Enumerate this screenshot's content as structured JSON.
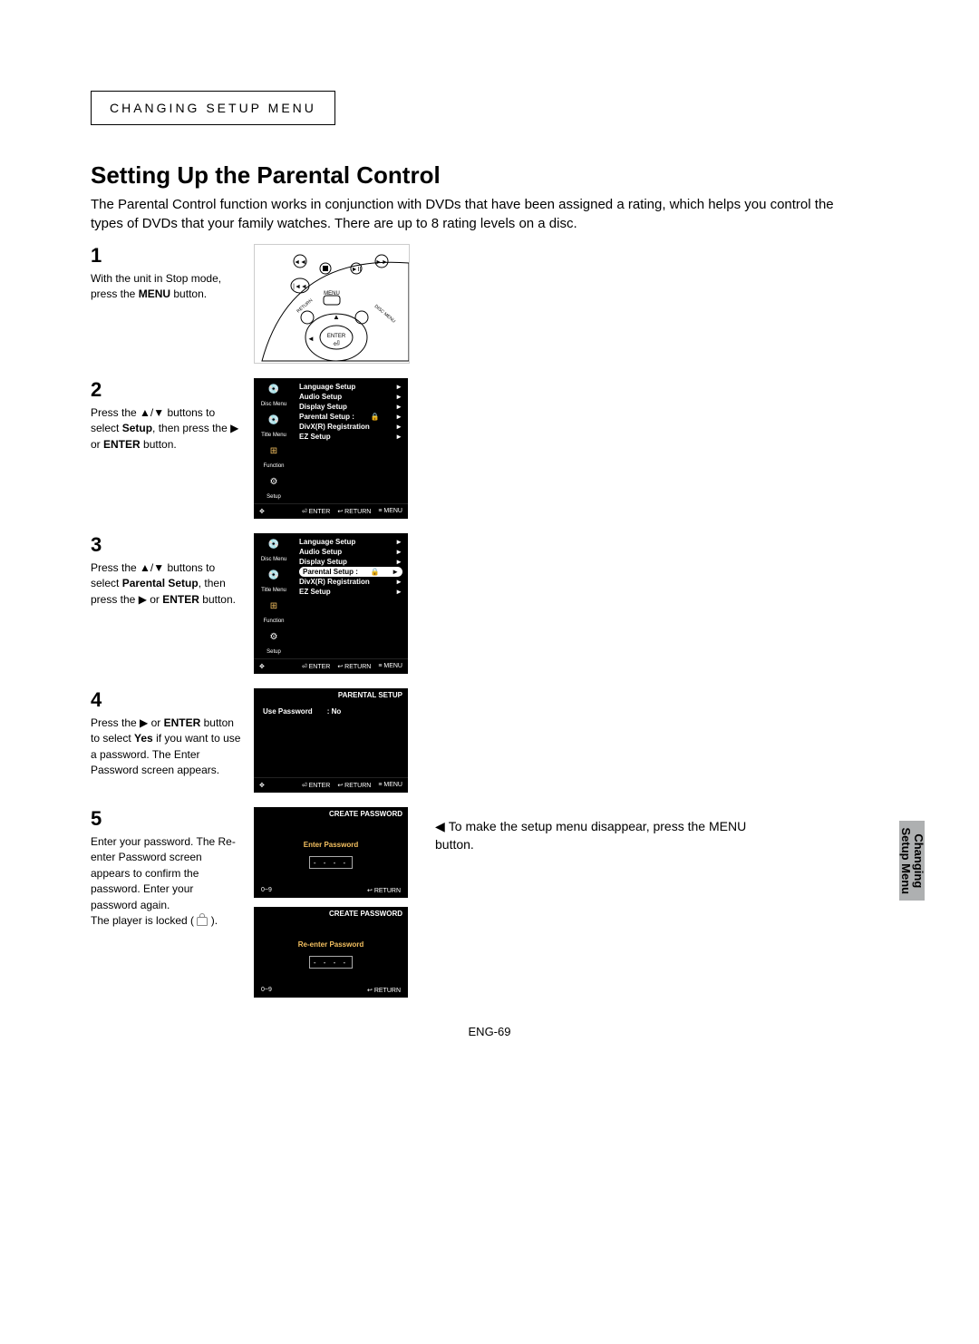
{
  "header": "CHANGING SETUP MENU",
  "title": "Setting Up the Parental Control",
  "intro": "The Parental Control function works in conjunction with DVDs that have been assigned a rating, which helps you control the types of DVDs that your family watches. There are up to 8 rating levels on a disc.",
  "steps": {
    "s1": {
      "num": "1",
      "text_a": "With the unit in Stop mode, press the ",
      "bold_a": "MENU",
      "text_b": " button."
    },
    "s2": {
      "num": "2",
      "text_a": "Press the ▲/▼ buttons to select ",
      "bold_a": "Setup",
      "text_b": ", then press the ▶ or ",
      "bold_b": "ENTER",
      "text_c": " button."
    },
    "s3": {
      "num": "3",
      "text_a": "Press the ▲/▼ buttons to select ",
      "bold_a": "Parental Setup",
      "text_b": ", then press the ▶ or ",
      "bold_b": "ENTER",
      "text_c": " button."
    },
    "s4": {
      "num": "4",
      "text_a": "Press the ▶ or ",
      "bold_a": "ENTER",
      "text_b": " button to select ",
      "bold_b": "Yes",
      "text_c": " if you want to use a password. The Enter Password screen appears."
    },
    "s5": {
      "num": "5",
      "text_a": "Enter your password. The Re-enter Password screen appears to confirm the password. Enter your password again.",
      "text_b": "The player is locked ( ",
      "text_c": " )."
    }
  },
  "menu": {
    "items": [
      "Language Setup",
      "Audio Setup",
      "Display Setup",
      "Parental Setup :",
      "DivX(R) Registration",
      "EZ Setup"
    ],
    "side": [
      "Disc Menu",
      "Title Menu",
      "Function",
      "Setup"
    ],
    "foot": [
      "ENTER",
      "RETURN",
      "MENU"
    ]
  },
  "parental": {
    "title": "PARENTAL SETUP",
    "row_label": "Use Password",
    "row_value": ": No"
  },
  "password": {
    "create_title": "CREATE PASSWORD",
    "enter_label": "Enter Password",
    "reenter_label": "Re-enter Password",
    "dots": "- - - -",
    "foot_left": "0~9",
    "foot_right": "RETURN"
  },
  "note": "To make the setup menu disappear, press the MENU button.",
  "sideTab": {
    "line1": "Changing",
    "line2": "Setup Menu"
  },
  "pagenum": "ENG-69"
}
